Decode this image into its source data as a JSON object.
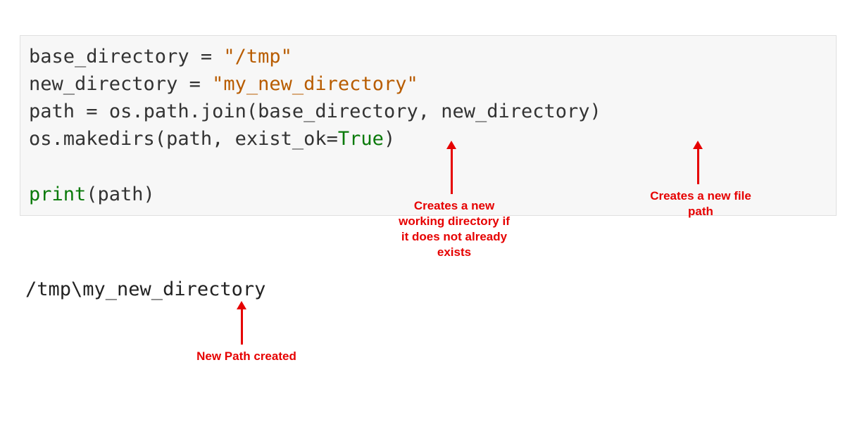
{
  "code": {
    "line1": {
      "var": "base_directory",
      "eq": " = ",
      "str_open": "\"",
      "str": "/tmp",
      "str_close": "\""
    },
    "line2": {
      "var": "new_directory",
      "eq": " = ",
      "str_open": "\"",
      "str": "my_new_directory",
      "str_close": "\""
    },
    "line3": {
      "var": "path",
      "eq": " = ",
      "expr": "os.path.join(base_directory, new_directory)"
    },
    "line4": {
      "prefix": "os.makedirs(path, exist_ok",
      "eq": "=",
      "kw": "True",
      "close": ")"
    },
    "line6": {
      "fn": "print",
      "args": "(path)"
    }
  },
  "output": {
    "text": "/tmp\\my_new_directory"
  },
  "annotations": {
    "makedirs": "Creates a new\nworking directory if\nit does not already\nexists",
    "join": "Creates a new file\npath",
    "result": "New Path created"
  },
  "colors": {
    "string": "#b85c00",
    "keyword": "#0a7a0a",
    "annotation": "#e60000",
    "codeBg": "#f7f7f7",
    "text": "#333333"
  }
}
